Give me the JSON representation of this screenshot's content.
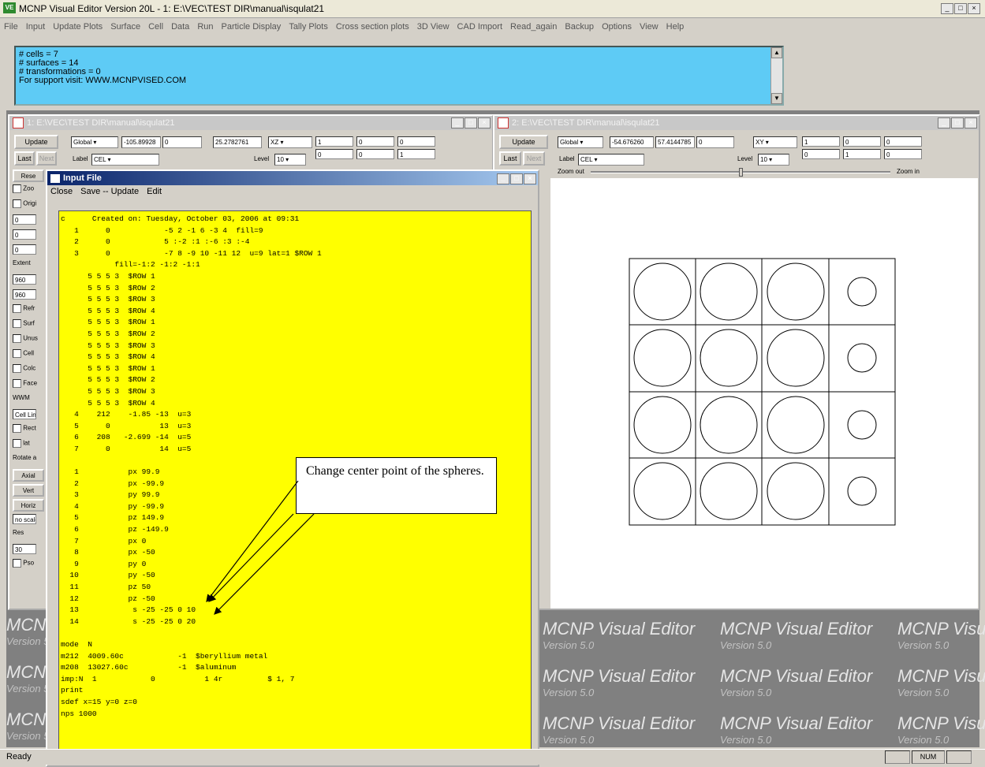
{
  "app": {
    "icon_text": "VE",
    "title": "MCNP Visual Editor Version 20L - 1: E:\\VEC\\TEST DIR\\manual\\isqulat21"
  },
  "menu": [
    "File",
    "Input",
    "Update Plots",
    "Surface",
    "Cell",
    "Data",
    "Run",
    "Particle Display",
    "Tally Plots",
    "Cross section plots",
    "3D View",
    "CAD Import",
    "Read_again",
    "Backup",
    "Options",
    "View",
    "Help"
  ],
  "info_lines": [
    "# cells = 7",
    "# surfaces = 14",
    "# transformations = 0",
    "For support visit: WWW.MCNPVISED.COM"
  ],
  "plot1": {
    "title": "1: E:\\VEC\\TEST DIR\\manual\\isqulat21",
    "update": "Update",
    "last": "Last",
    "next": "Next",
    "coord_system": "Global",
    "coord1": "-105.89928",
    "coord2": "0",
    "coord3": "25.2782761",
    "axis": "XZ",
    "label_label": "Label",
    "label_value": "CEL",
    "level_label": "Level",
    "level_value": "10",
    "m1": [
      "1",
      "0",
      "0"
    ],
    "m2": [
      "0",
      "0",
      "1"
    ],
    "left_items": [
      "Rese",
      "Zoo",
      "Origi",
      "0",
      "0",
      "0",
      "Extent",
      "960",
      "960",
      "Refr",
      "Surf",
      "Unus",
      "Cell",
      "Colc",
      "Face",
      "WWM",
      "Cell Line",
      "Rect",
      "lat",
      "Rotate a",
      "Axial",
      "Vert",
      "Horiz",
      "no scale",
      "Res",
      "30",
      "Pso"
    ]
  },
  "plot2": {
    "title": "2: E:\\VEC\\TEST DIR\\manual\\isqulat21",
    "update": "Update",
    "last": "Last",
    "next": "Next",
    "coord_system": "Global",
    "coord1": "-54.676260",
    "coord2": "57.4144785",
    "coord3": "0",
    "axis": "XY",
    "label_label": "Label",
    "label_value": "CEL",
    "level_label": "Level",
    "level_value": "10",
    "m1": [
      "1",
      "0",
      "0"
    ],
    "m2": [
      "0",
      "1",
      "0"
    ],
    "zoom_out": "Zoom out",
    "zoom_in": "Zoom in"
  },
  "input_file": {
    "title": "Input File",
    "menu": [
      "Close",
      "Save -- Update",
      "Edit"
    ],
    "text": "c      Created on: Tuesday, October 03, 2006 at 09:31\n   1      0            -5 2 -1 6 -3 4  fill=9\n   2      0            5 :-2 :1 :-6 :3 :-4\n   3      0            -7 8 -9 10 -11 12  u=9 lat=1 $ROW 1\n            fill=-1:2 -1:2 -1:1\n      5 5 5 3  $ROW 1\n      5 5 5 3  $ROW 2\n      5 5 5 3  $ROW 3\n      5 5 5 3  $ROW 4\n      5 5 5 3  $ROW 1\n      5 5 5 3  $ROW 2\n      5 5 5 3  $ROW 3\n      5 5 5 3  $ROW 4\n      5 5 5 3  $ROW 1\n      5 5 5 3  $ROW 2\n      5 5 5 3  $ROW 3\n      5 5 5 3  $ROW 4\n   4    212    -1.85 -13  u=3\n   5      0           13  u=3\n   6    208   -2.699 -14  u=5\n   7      0           14  u=5\n\n   1           px 99.9\n   2           px -99.9\n   3           py 99.9\n   4           py -99.9\n   5           pz 149.9\n   6           pz -149.9\n   7           px 0\n   8           px -50\n   9           py 0\n  10           py -50\n  11           pz 50\n  12           pz -50\n  13            s -25 -25 0 10\n  14            s -25 -25 0 20\n\nmode  N\nm212  4009.60c            -1  $beryllium metal\nm208  13027.60c           -1  $aluminum\nimp:N  1            0           1 4r          $ 1, 7\nprint\nsdef x=15 y=0 z=0\nnps 1000"
  },
  "callout": "Change center point of the spheres.",
  "watermark": {
    "title": "MCNP Visual Editor",
    "version": "Version 5.0"
  },
  "status": {
    "left": "Ready",
    "num": "NUM"
  },
  "colors": {
    "info_bg": "#5ecbf5",
    "editor_bg": "#ffff00",
    "titlebar_active": "#0a246a"
  }
}
